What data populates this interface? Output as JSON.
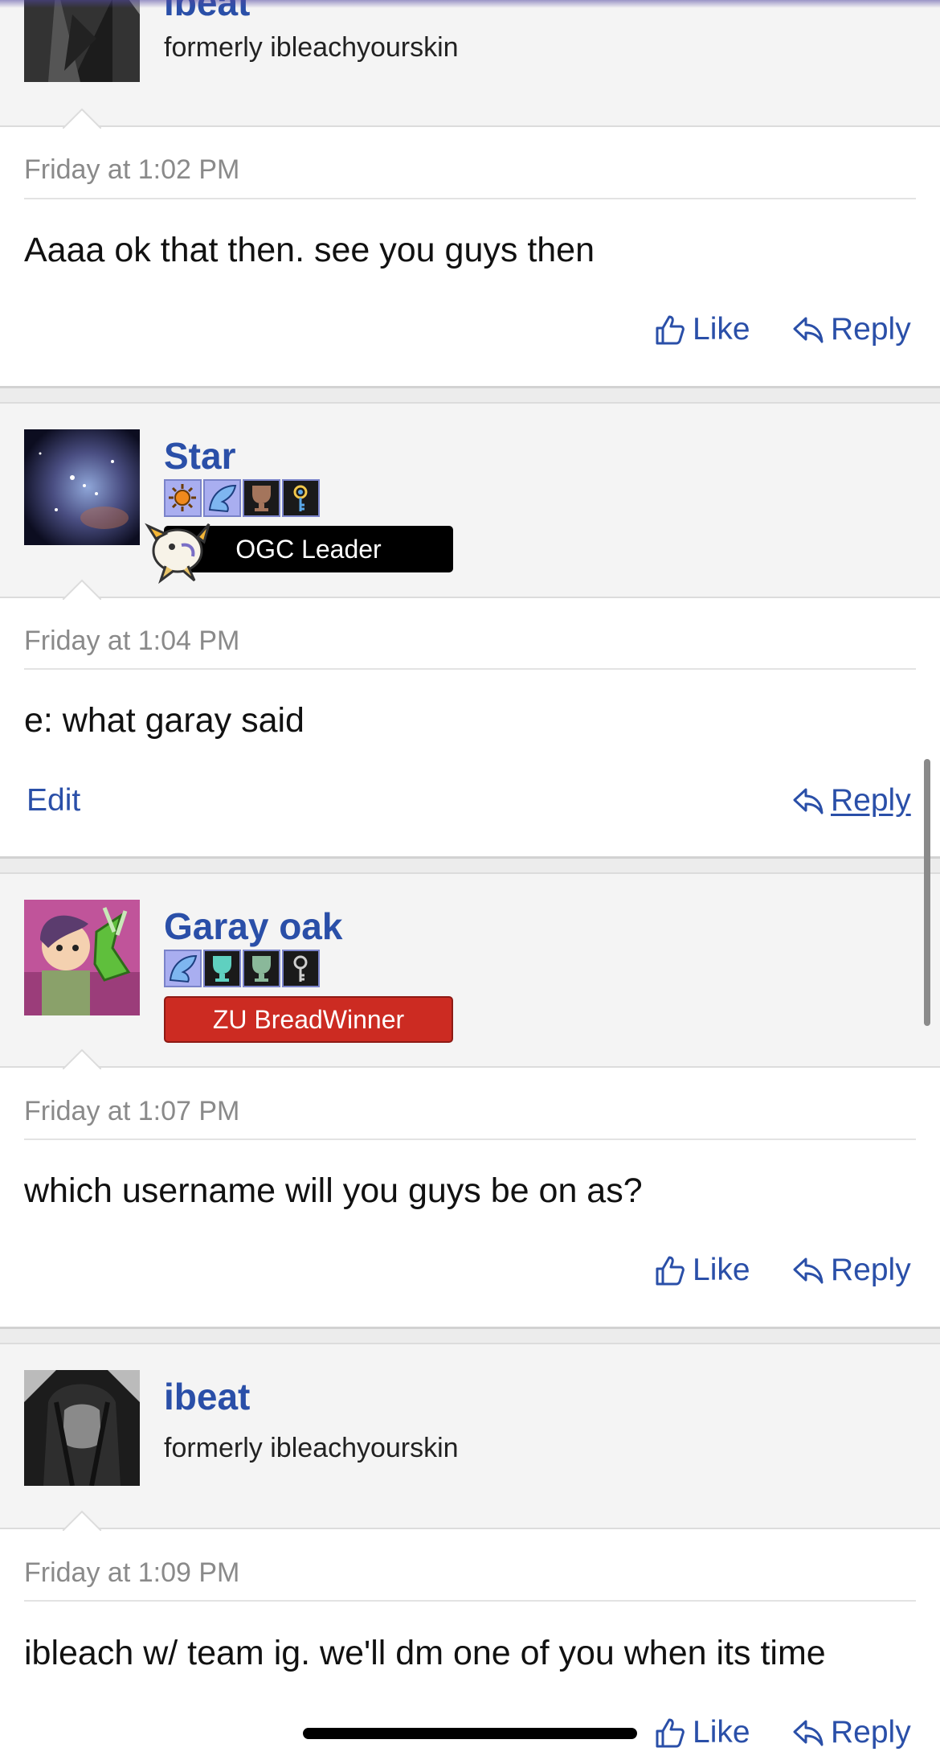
{
  "posts": [
    {
      "username": "ibeat",
      "subtitle": "formerly ibleachyourskin",
      "timestamp": "Friday at 1:02 PM",
      "message": "Aaaa ok that then. see you guys then",
      "actions": {
        "like": "Like",
        "reply": "Reply"
      }
    },
    {
      "username": "Star",
      "banner": "OGC Leader",
      "timestamp": "Friday at 1:04 PM",
      "message": "e: what garay said",
      "actions": {
        "edit": "Edit",
        "reply": "Reply"
      }
    },
    {
      "username": "Garay oak",
      "banner": "ZU BreadWinner",
      "timestamp": "Friday at 1:07 PM",
      "message": "which username will you guys be on as?",
      "actions": {
        "like": "Like",
        "reply": "Reply"
      }
    },
    {
      "username": "ibeat",
      "subtitle": "formerly ibleachyourskin",
      "timestamp": "Friday at 1:09 PM",
      "message": "ibleach w/ team ig. we'll dm one of you when its time",
      "actions": {
        "like": "Like",
        "reply": "Reply"
      }
    }
  ],
  "colors": {
    "link": "#2a4fa8",
    "banner_ogc": "#000000",
    "banner_zu": "#cc2b22"
  }
}
